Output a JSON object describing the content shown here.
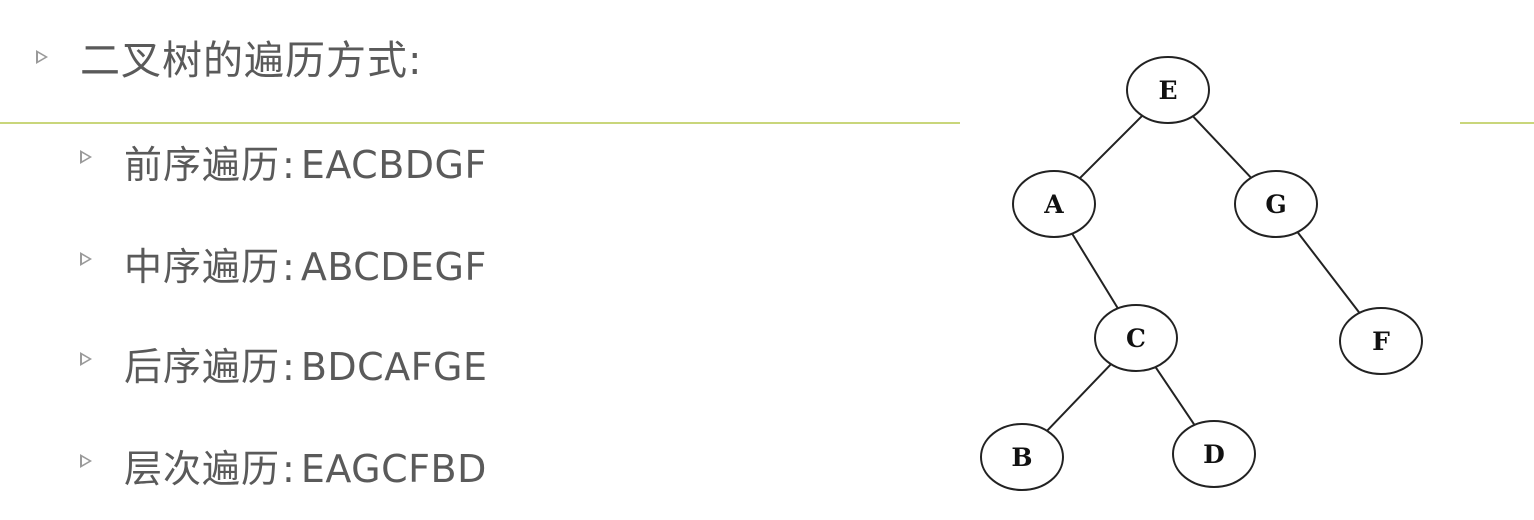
{
  "title": "二叉树的遍历方式:",
  "traversals": [
    {
      "label": "前序遍历",
      "sep": ":",
      "value": "EACBDGF"
    },
    {
      "label": "中序遍历",
      "sep": ":",
      "value": "ABCDEGF"
    },
    {
      "label": "后序遍历",
      "sep": ":",
      "value": "BDCAFGE"
    },
    {
      "label": "层次遍历",
      "sep": ":",
      "value": "EAGCFBD"
    }
  ],
  "tree": {
    "nodes": [
      "E",
      "A",
      "G",
      "C",
      "F",
      "B",
      "D"
    ],
    "edges": [
      [
        "E",
        "A"
      ],
      [
        "E",
        "G"
      ],
      [
        "A",
        "C"
      ],
      [
        "G",
        "F"
      ],
      [
        "C",
        "B"
      ],
      [
        "C",
        "D"
      ]
    ]
  },
  "colors": {
    "text": "#5a5a5a",
    "bullet": "#9a9a9a",
    "rule": "#c9d67b",
    "node_stroke": "#222222"
  }
}
